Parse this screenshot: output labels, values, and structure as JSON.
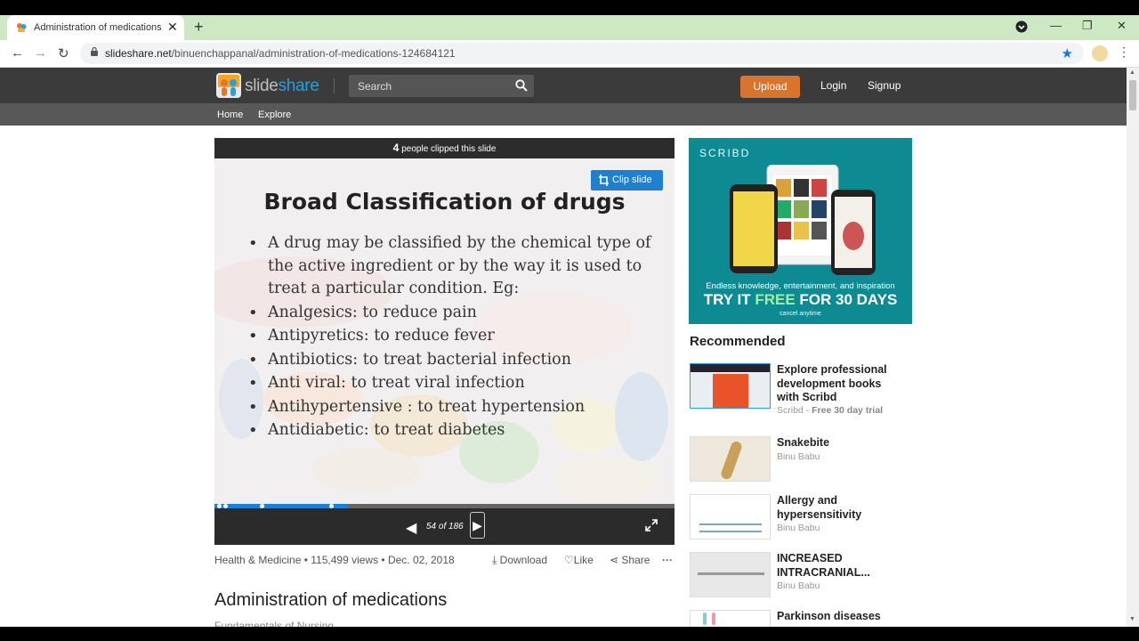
{
  "browser": {
    "tab_title": "Administration of medications",
    "url_domain": "slideshare.net",
    "url_path": "/binuenchappanal/administration-of-medications-124684121"
  },
  "header": {
    "logo_part1": "slide",
    "logo_part2": "share",
    "search_placeholder": "Search",
    "upload_label": "Upload",
    "login_label": "Login",
    "signup_label": "Signup"
  },
  "subnav": {
    "home": "Home",
    "explore": "Explore"
  },
  "player": {
    "clip_count": "4",
    "clip_text": "people clipped this slide",
    "clip_button": "Clip slide",
    "slide_title": "Broad Classification of drugs",
    "bullets": [
      "A drug may be classified by the chemical type of the active ingredient or by the way it is used to treat a particular condition. Eg:",
      "Analgesics: to reduce pain",
      "Antipyretics: to reduce fever",
      "Antibiotics: to treat bacterial infection",
      "Anti viral: to treat viral infection",
      "Antihypertensive : to treat hypertension",
      "Antidiabetic: to treat diabetes"
    ],
    "counter": "54 of 186",
    "current_slide": 54,
    "total_slides": 186
  },
  "meta": {
    "category": "Health & Medicine",
    "sep": " • ",
    "views": "115,499 views",
    "date": "Dec. 02, 2018",
    "download": "Download",
    "like": "Like",
    "share": "Share",
    "more": "···"
  },
  "doc": {
    "title": "Administration of medications",
    "subtitle": "Fundamentals of Nursing"
  },
  "ad": {
    "brand": "SCRIBD",
    "tagline": "Endless knowledge, entertainment, and inspiration",
    "cta_a": "TRY IT ",
    "cta_b": "FREE",
    "cta_c": " FOR 30 DAYS",
    "cancel": "cancel anytime"
  },
  "recommended": {
    "heading": "Recommended",
    "items": [
      {
        "title": "Explore professional development books with Scribd",
        "author": "Scribd",
        "extra": "Free 30 day trial"
      },
      {
        "title": "Snakebite",
        "author": "Binu Babu"
      },
      {
        "title": "Allergy and hypersensitivity",
        "author": "Binu Babu"
      },
      {
        "title": "INCREASED INTRACRANIAL...",
        "author": "Binu Babu"
      },
      {
        "title": "Parkinson diseases",
        "author": ""
      }
    ]
  },
  "colors": {
    "brand_blue": "#2a9fd6",
    "upload_orange": "#d8742c",
    "clip_blue": "#1f7fd0",
    "ad_teal": "#0e8a93"
  }
}
